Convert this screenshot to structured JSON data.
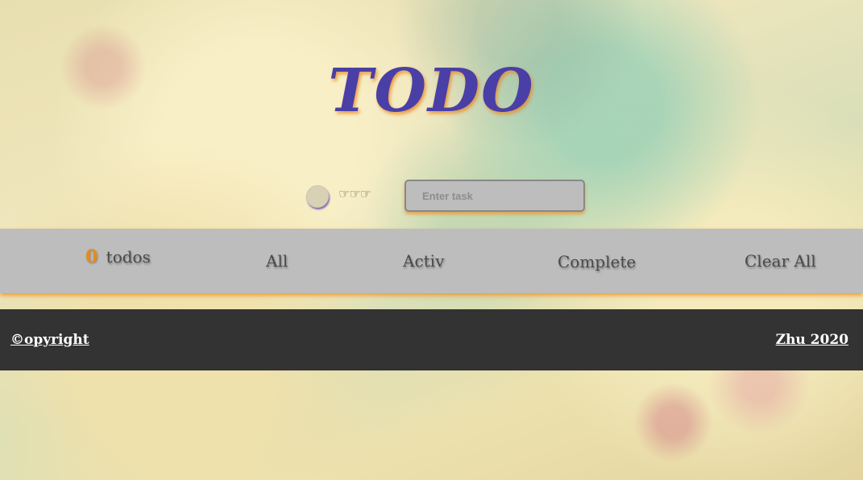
{
  "app": {
    "title": "TODO"
  },
  "input_row": {
    "pointer_glyphs": "☞☞☞",
    "task_placeholder": "Enter task",
    "task_value": ""
  },
  "filter_bar": {
    "count": "0",
    "count_label": "todos",
    "filters": {
      "all": "All",
      "active": "Activ",
      "complete": "Complete"
    },
    "clear_all": "Clear All"
  },
  "footer": {
    "copyright": "©opyright",
    "author": "Zhu 2020"
  },
  "colors": {
    "title": "#4a3fa6",
    "title_shadow": "#e68c28",
    "count": "#e88b1a",
    "filter_bar_bg": "#bdbdbd",
    "footer_bg": "#333333"
  },
  "icons": {
    "toggle_all": "circle-toggle-icon",
    "pointers": "pointing-hand-icon"
  }
}
